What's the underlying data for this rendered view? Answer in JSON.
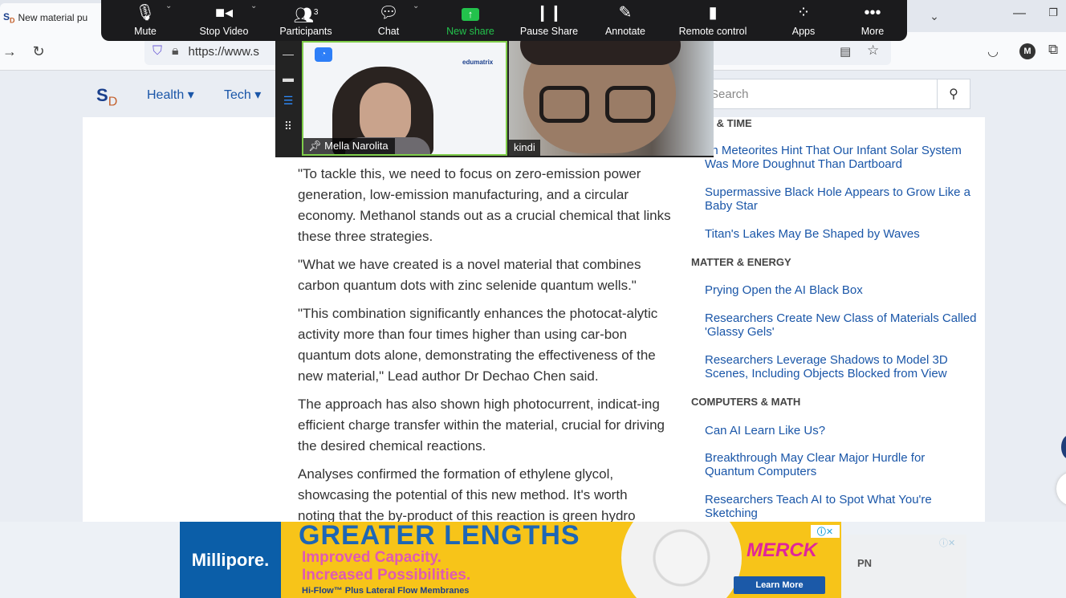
{
  "browser": {
    "tab_title": "New material pu",
    "tab_favicon": "SD",
    "url": "https://www.s",
    "icons": {
      "tab_list": "chevron-down-icon",
      "minimize": "minimize-icon",
      "maximize": "restore-icon",
      "forward": "arrow-right-icon",
      "reload": "reload-icon",
      "shield": "shield-icon",
      "lock": "lock-icon",
      "reader": "reader-view-icon",
      "bookmark": "star-icon",
      "pocket": "pocket-icon",
      "extensions": "extensions-icon"
    },
    "account_initial": "M"
  },
  "zoom_toolbar": {
    "items": [
      {
        "label": "Mute",
        "icon": "microphone-icon"
      },
      {
        "label": "Stop Video",
        "icon": "video-camera-icon"
      },
      {
        "label": "Participants",
        "icon": "participants-icon",
        "count": "3"
      },
      {
        "label": "Chat",
        "icon": "chat-bubble-icon"
      },
      {
        "label": "New share",
        "icon": "share-screen-icon"
      },
      {
        "label": "Pause Share",
        "icon": "pause-icon"
      },
      {
        "label": "Annotate",
        "icon": "pencil-icon"
      },
      {
        "label": "Remote control",
        "icon": "mouse-icon"
      },
      {
        "label": "Apps",
        "icon": "apps-icon"
      },
      {
        "label": "More",
        "icon": "more-dots-icon"
      }
    ],
    "colors": {
      "background": "#1b1b1d",
      "share": "#23c24c"
    }
  },
  "zoom_video": {
    "participants": [
      {
        "name": "Mella Narolita",
        "pinned": true,
        "active_speaker": true,
        "background_brand": "edumatrix"
      },
      {
        "name": "kindi",
        "pinned": false,
        "active_speaker": false
      }
    ],
    "active_border_color": "#7fcd4a"
  },
  "site": {
    "logo_main": "S",
    "logo_sub": "D",
    "nav": [
      {
        "label": "Health ▾"
      },
      {
        "label": "Tech ▾"
      }
    ],
    "search_placeholder": "Search",
    "colors": {
      "link": "#1a56a8",
      "logo_blue": "#1a3f8c",
      "logo_orange": "#c4602c"
    }
  },
  "article": {
    "paragraphs": [
      "\"To tackle this, we need to focus on zero-emission power generation, low-emission manufacturing, and a circular economy. Methanol stands out as a crucial chemical that links these three strategies.",
      "\"What we have created is a novel material that combines carbon quantum dots with zinc selenide quantum wells.\"",
      "\"This combination significantly enhances the photocat-alytic activity more than four times higher than using car-bon quantum dots alone, demonstrating the effectiveness of the new material,\" Lead author Dr Dechao Chen said.",
      "The approach has also shown high photocurrent, indicat-ing efficient charge transfer within the material, crucial for driving the desired chemical reactions.",
      "Analyses confirmed the formation of ethylene glycol, showcasing the potential of this new method. It's worth",
      "noting that the by-product of this reaction is green hydro"
    ]
  },
  "sidebar": {
    "sections": [
      {
        "heading": "CE & TIME",
        "links": [
          "on Meteorites Hint That Our Infant Solar System Was More Doughnut Than Dartboard",
          "Supermassive Black Hole Appears to Grow Like a Baby Star",
          "Titan's Lakes May Be Shaped by Waves"
        ]
      },
      {
        "heading": "MATTER & ENERGY",
        "links": [
          "Prying Open the AI Black Box",
          "Researchers Create New Class of Materials Called 'Glassy Gels'",
          "Researchers Leverage Shadows to Model 3D Scenes, Including Objects Blocked from View"
        ]
      },
      {
        "heading": "COMPUTERS & MATH",
        "links": [
          "Can AI Learn Like Us?",
          "Breakthrough May Clear Major Hurdle for Quantum Computers",
          "Researchers Teach AI to Spot What You're Sketching"
        ]
      }
    ]
  },
  "ad": {
    "brand": "Millipore.",
    "headline": "GREATER LENGTHS",
    "line1": "Improved Capacity.",
    "line2": "Increased Possibilities.",
    "line3": "Hi-Flow™ Plus Lateral Flow Membranes",
    "sponsor": "MERCK",
    "cta": "Learn More",
    "choices": "ⓘ✕",
    "side_text": "PN",
    "side_choices": "ⓘ✕",
    "colors": {
      "bg": "#f7c419",
      "headline": "#1d66b5",
      "accent": "#e05ab2",
      "merck": "#e0259b"
    }
  }
}
